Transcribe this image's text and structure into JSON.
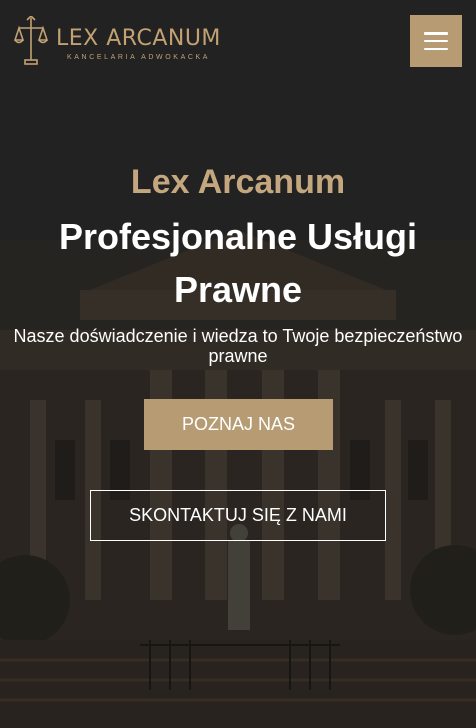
{
  "header": {
    "logo_name": "LEX ARCANUM",
    "logo_tagline": "KANCELARIA ADWOKACKA",
    "menu_icon": "hamburger-menu-icon",
    "brand_color": "#c2a172"
  },
  "hero": {
    "brand": "Lex Arcanum",
    "headline": "Profesjonalne Usługi Prawne",
    "subtext": "Nasze doświadczenie i wiedza to Twoje bezpieczeństwo prawne",
    "primary_button": "POZNAJ NAS",
    "secondary_button": "SKONTAKTUJ SIĘ Z NAMI",
    "accent_color": "#b79c73"
  }
}
